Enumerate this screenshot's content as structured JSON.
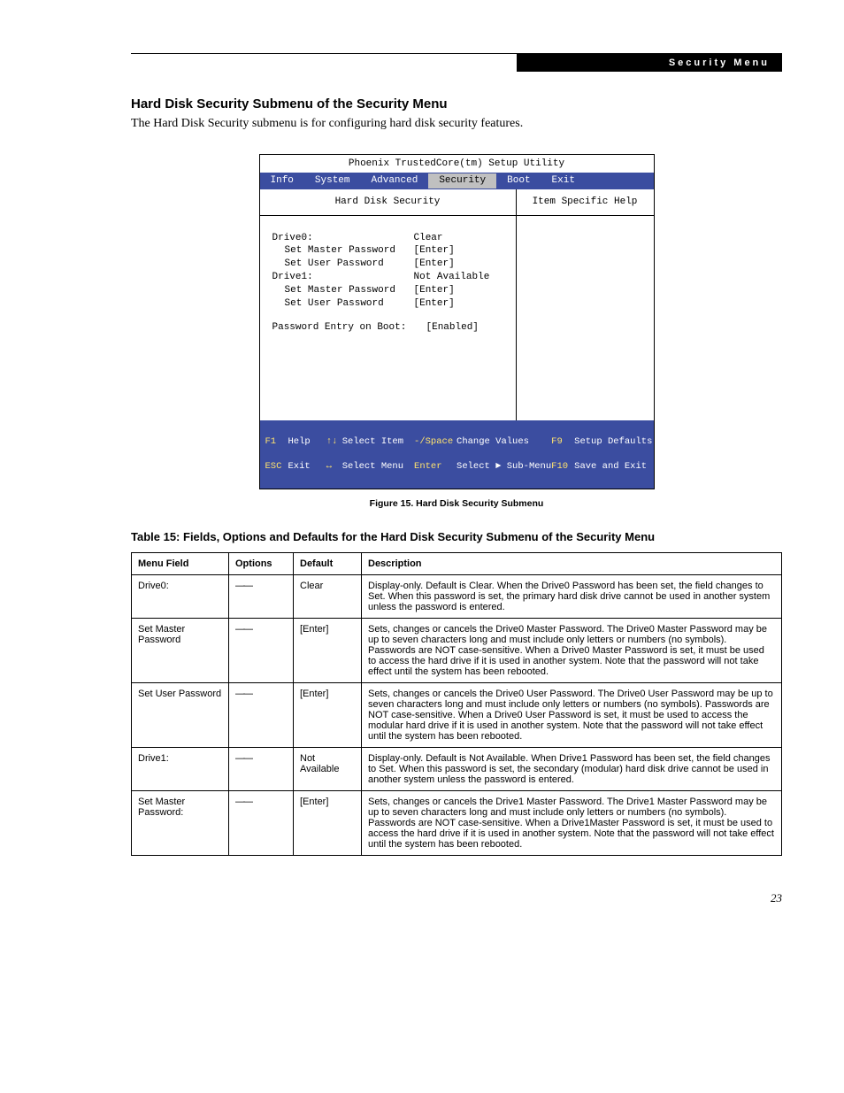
{
  "header": {
    "section_label": "Security Menu"
  },
  "heading": "Hard Disk Security Submenu of the Security Menu",
  "intro": "The Hard Disk Security submenu is for configuring hard disk security features.",
  "bios": {
    "window_title": "Phoenix TrustedCore(tm) Setup Utility",
    "menu": [
      "Info",
      "System",
      "Advanced",
      "Security",
      "Boot",
      "Exit"
    ],
    "selected_menu": "Security",
    "left_title": "Hard Disk Security",
    "right_title": "Item Specific Help",
    "rows": [
      {
        "label": "Drive0:",
        "value": "Clear",
        "indent": false
      },
      {
        "label": "Set Master Password",
        "value": "[Enter]",
        "indent": true
      },
      {
        "label": "Set User Password",
        "value": "[Enter]",
        "indent": true
      },
      {
        "label": "Drive1:",
        "value": "Not Available",
        "indent": false
      },
      {
        "label": "Set Master Password",
        "value": "[Enter]",
        "indent": true
      },
      {
        "label": "Set User Password",
        "value": "[Enter]",
        "indent": true
      }
    ],
    "extra_row": {
      "label": "Password Entry on Boot:",
      "value": "[Enabled]"
    },
    "footer": {
      "l1_k1": "F1",
      "l1_v1": "Help",
      "l1_k2": "↑↓",
      "l1_v2": "Select Item",
      "l1_k3": "-/Space",
      "l1_v3": "Change Values",
      "l1_k4": "F9",
      "l1_v4": "Setup Defaults",
      "l2_k1": "ESC",
      "l2_v1": "Exit",
      "l2_k2": "↔",
      "l2_v2": "Select Menu",
      "l2_k3": "Enter",
      "l2_v3": "Select ► Sub-Menu",
      "l2_k4": "F10",
      "l2_v4": "Save and Exit"
    }
  },
  "figure_caption": "Figure 15.   Hard Disk Security Submenu",
  "table_title": "Table 15: Fields, Options and Defaults for the Hard Disk Security Submenu of the Security Menu",
  "table": {
    "headers": [
      "Menu Field",
      "Options",
      "Default",
      "Description"
    ],
    "rows": [
      {
        "field": "Drive0:",
        "options": "",
        "default": "Clear",
        "desc": "Display-only. Default is Clear. When the Drive0 Password has been set, the field changes to Set. When this password is set, the primary hard disk drive cannot be used in another system unless the password is entered."
      },
      {
        "field": "Set Master Password",
        "options": "",
        "default": "[Enter]",
        "desc": "Sets, changes or cancels the Drive0 Master Password. The Drive0 Master Password may be up to seven characters long and must include only letters or numbers (no symbols). Passwords are NOT case-sensitive. When a Drive0 Master Password is set, it must be used to access the hard drive if it is used in another system. Note that the password will not take effect until the system has been rebooted."
      },
      {
        "field": "Set User Password",
        "options": "",
        "default": "[Enter]",
        "desc": "Sets, changes or cancels the Drive0 User Password. The Drive0 User Password may be up to seven characters long and must include only letters or numbers (no symbols). Passwords are NOT case-sensitive. When a Drive0 User Password is set, it must be used to access the modular hard drive if it is used in another system. Note that the password will not take effect until the system has been rebooted."
      },
      {
        "field": "Drive1:",
        "options": "",
        "default": "Not Available",
        "desc": "Display-only. Default is Not Available. When Drive1 Password has been set, the field changes to Set. When this password is set, the secondary (modular) hard disk drive cannot be used in another system unless the password is entered."
      },
      {
        "field": "Set Master Password:",
        "options": "",
        "default": "[Enter]",
        "desc": "Sets, changes or cancels the Drive1 Master Password. The Drive1 Master Password may be up to seven characters long and must include only letters or numbers (no symbols). Passwords are NOT case-sensitive. When a Drive1Master Password is set, it must be used to access the hard drive if it is used in another system. Note that the password will not take effect until the system has been rebooted."
      }
    ]
  },
  "page_number": "23"
}
